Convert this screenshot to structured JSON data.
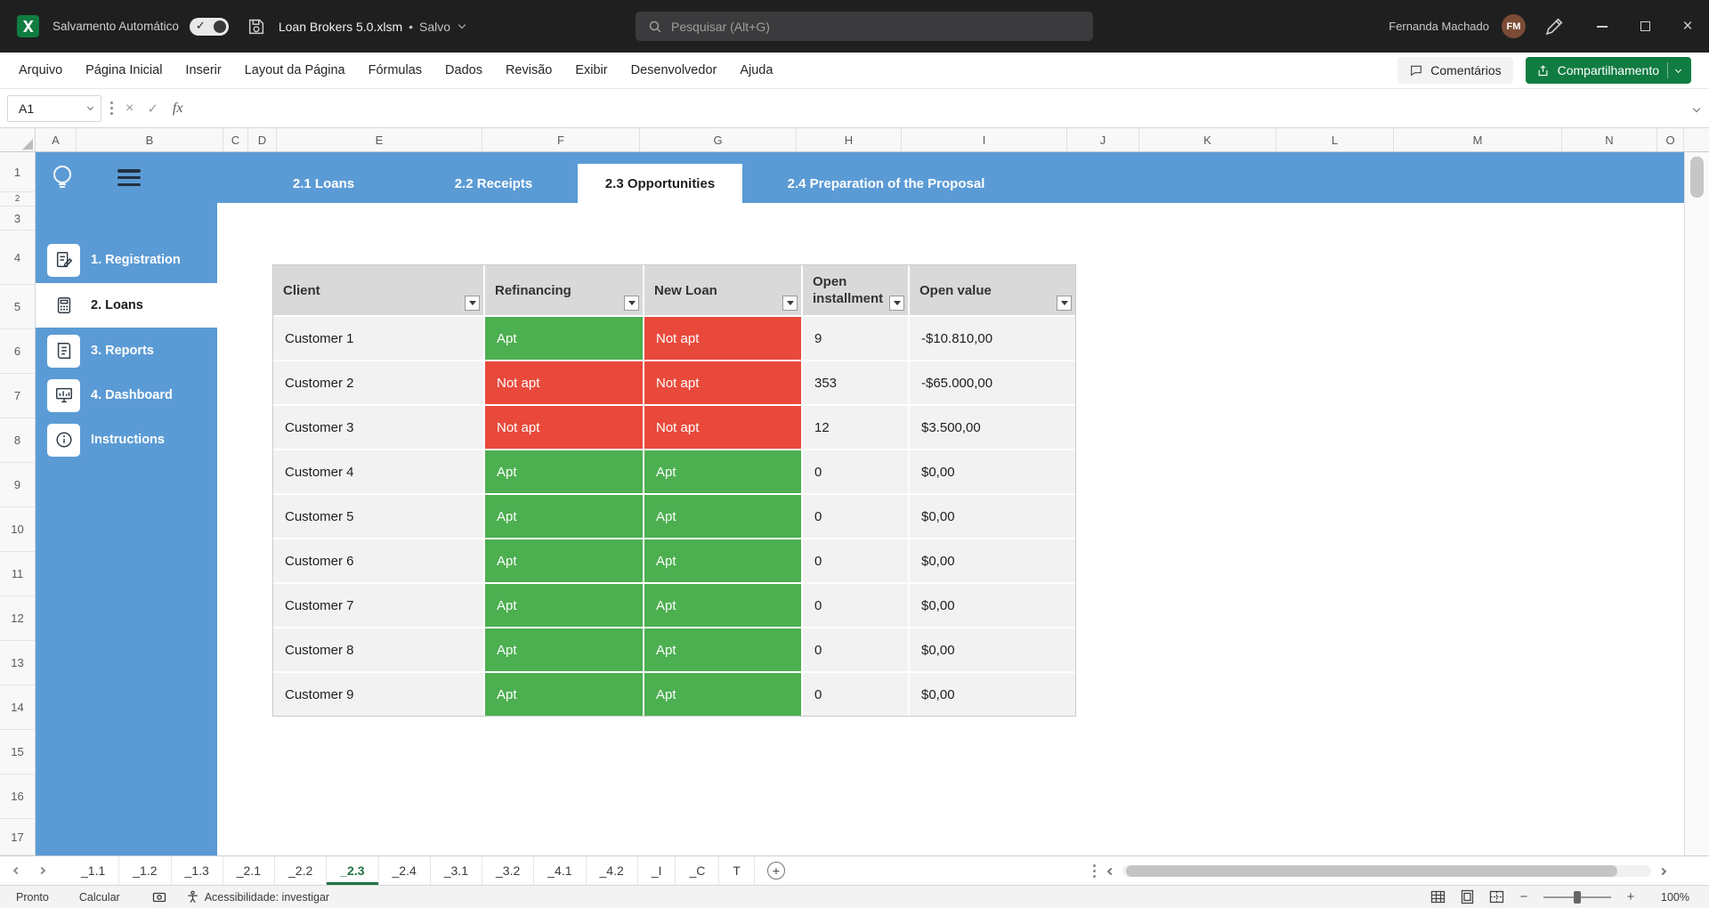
{
  "colors": {
    "accent-blue": "#5B9BD5",
    "status-green": "#4CAF50",
    "status-red": "#E9493B",
    "excel-green": "#107C41",
    "sheet-green": "#217346",
    "table-header-gray": "#D9D9D9",
    "row-gray": "#F2F2F2"
  },
  "titlebar": {
    "autosave_label": "Salvamento Automático",
    "filename": "Loan Brokers 5.0.xlsm",
    "separator": "•",
    "file_status": "Salvo",
    "search_placeholder": "Pesquisar (Alt+G)",
    "user_name": "Fernanda Machado",
    "user_initials": "FM"
  },
  "menubar": {
    "items": [
      "Arquivo",
      "Página Inicial",
      "Inserir",
      "Layout da Página",
      "Fórmulas",
      "Dados",
      "Revisão",
      "Exibir",
      "Desenvolvedor",
      "Ajuda"
    ],
    "comments_label": "Comentários",
    "share_label": "Compartilhamento"
  },
  "formula_bar": {
    "name_box_value": "A1",
    "fx_label": "fx",
    "formula_value": ""
  },
  "sheet": {
    "column_headers": [
      "A",
      "B",
      "C",
      "D",
      "E",
      "F",
      "G",
      "H",
      "I",
      "J",
      "K",
      "L",
      "M",
      "N",
      "O"
    ],
    "row_numbers": [
      "1",
      "2",
      "3",
      "4",
      "5",
      "6",
      "7",
      "8",
      "9",
      "10",
      "11",
      "12",
      "13",
      "14",
      "15",
      "16",
      "17"
    ]
  },
  "workbook_ui": {
    "nav_tabs": [
      {
        "label": "2.1 Loans",
        "active": false
      },
      {
        "label": "2.2 Receipts",
        "active": false
      },
      {
        "label": "2.3 Opportunities",
        "active": true
      },
      {
        "label": "2.4 Preparation of the Proposal",
        "active": false
      }
    ],
    "sidebar_items": [
      {
        "label": "1. Registration",
        "active": false
      },
      {
        "label": "2. Loans",
        "active": true
      },
      {
        "label": "3. Reports",
        "active": false
      },
      {
        "label": "4. Dashboard",
        "active": false
      },
      {
        "label": "Instructions",
        "active": false
      }
    ]
  },
  "table": {
    "headers": {
      "client": "Client",
      "refinancing": "Refinancing",
      "new_loan": "New Loan",
      "open_installment": "Open installment",
      "open_value": "Open value"
    },
    "rows": [
      {
        "client": "Customer 1",
        "refinancing": "Apt",
        "refinancing_status": "apt",
        "new_loan": "Not apt",
        "new_loan_status": "not-apt",
        "open_installment": "9",
        "open_value": "-$10.810,00"
      },
      {
        "client": "Customer 2",
        "refinancing": "Not apt",
        "refinancing_status": "not-apt",
        "new_loan": "Not apt",
        "new_loan_status": "not-apt",
        "open_installment": "353",
        "open_value": "-$65.000,00"
      },
      {
        "client": "Customer 3",
        "refinancing": "Not apt",
        "refinancing_status": "not-apt",
        "new_loan": "Not apt",
        "new_loan_status": "not-apt",
        "open_installment": "12",
        "open_value": "$3.500,00"
      },
      {
        "client": "Customer 4",
        "refinancing": "Apt",
        "refinancing_status": "apt",
        "new_loan": "Apt",
        "new_loan_status": "apt",
        "open_installment": "0",
        "open_value": "$0,00"
      },
      {
        "client": "Customer 5",
        "refinancing": "Apt",
        "refinancing_status": "apt",
        "new_loan": "Apt",
        "new_loan_status": "apt",
        "open_installment": "0",
        "open_value": "$0,00"
      },
      {
        "client": "Customer 6",
        "refinancing": "Apt",
        "refinancing_status": "apt",
        "new_loan": "Apt",
        "new_loan_status": "apt",
        "open_installment": "0",
        "open_value": "$0,00"
      },
      {
        "client": "Customer 7",
        "refinancing": "Apt",
        "refinancing_status": "apt",
        "new_loan": "Apt",
        "new_loan_status": "apt",
        "open_installment": "0",
        "open_value": "$0,00"
      },
      {
        "client": "Customer 8",
        "refinancing": "Apt",
        "refinancing_status": "apt",
        "new_loan": "Apt",
        "new_loan_status": "apt",
        "open_installment": "0",
        "open_value": "$0,00"
      },
      {
        "client": "Customer 9",
        "refinancing": "Apt",
        "refinancing_status": "apt",
        "new_loan": "Apt",
        "new_loan_status": "apt",
        "open_installment": "0",
        "open_value": "$0,00"
      }
    ]
  },
  "sheet_tabs": {
    "tabs": [
      {
        "label": "_1.1",
        "active": false
      },
      {
        "label": "_1.2",
        "active": false
      },
      {
        "label": "_1.3",
        "active": false
      },
      {
        "label": "_2.1",
        "active": false
      },
      {
        "label": "_2.2",
        "active": false
      },
      {
        "label": "_2.3",
        "active": true
      },
      {
        "label": "_2.4",
        "active": false
      },
      {
        "label": "_3.1",
        "active": false
      },
      {
        "label": "_3.2",
        "active": false
      },
      {
        "label": "_4.1",
        "active": false
      },
      {
        "label": "_4.2",
        "active": false
      },
      {
        "label": "_I",
        "active": false
      },
      {
        "label": "_C",
        "active": false
      },
      {
        "label": "T",
        "active": false
      }
    ],
    "add_label": "+"
  },
  "status_bar": {
    "ready_label": "Pronto",
    "calc_label": "Calcular",
    "accessibility_label": "Acessibilidade: investigar",
    "zoom_label": "100%"
  }
}
